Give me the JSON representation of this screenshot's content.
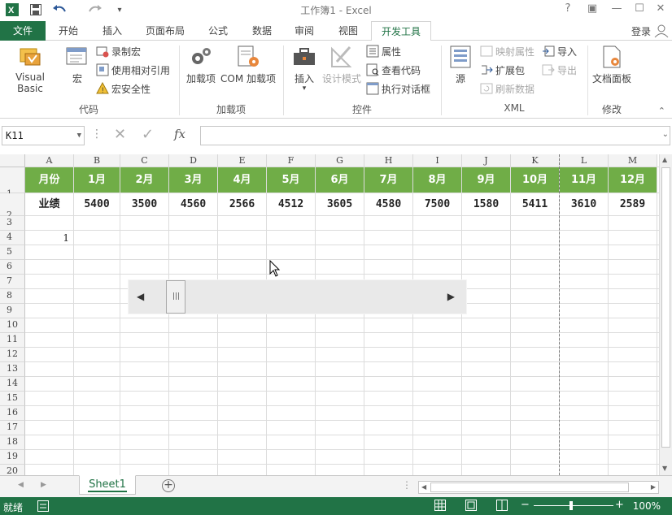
{
  "app": {
    "title": "工作簿1 - Excel",
    "login": "登录"
  },
  "tabs": [
    "文件",
    "开始",
    "插入",
    "页面布局",
    "公式",
    "数据",
    "审阅",
    "视图",
    "开发工具"
  ],
  "ribbon": {
    "groups": [
      {
        "label": "代码",
        "big": [
          "Visual Basic",
          "宏"
        ],
        "small": [
          "录制宏",
          "使用相对引用",
          "宏安全性"
        ]
      },
      {
        "label": "加载项",
        "big": [
          "加载项",
          "COM 加载项"
        ]
      },
      {
        "label": "控件",
        "big": [
          "插入",
          "设计模式"
        ],
        "small": [
          "属性",
          "查看代码",
          "执行对话框"
        ]
      },
      {
        "label": "XML",
        "big": [
          "源"
        ],
        "small": [
          "映射属性",
          "扩展包",
          "刷新数据",
          "导入",
          "导出"
        ]
      },
      {
        "label": "修改",
        "big": [
          "文档面板"
        ]
      }
    ]
  },
  "formula_bar": {
    "name_box": "K11",
    "fx": "fx",
    "value": ""
  },
  "grid": {
    "columns": [
      "A",
      "B",
      "C",
      "D",
      "E",
      "F",
      "G",
      "H",
      "I",
      "J",
      "K",
      "L",
      "M"
    ],
    "rows": [
      "1",
      "2",
      "3",
      "4",
      "5",
      "6",
      "7",
      "8",
      "9",
      "10",
      "11",
      "12",
      "13",
      "14",
      "15",
      "16",
      "17",
      "18",
      "19",
      "20"
    ],
    "row1": [
      "月份",
      "1月",
      "2月",
      "3月",
      "4月",
      "5月",
      "6月",
      "7月",
      "8月",
      "9月",
      "10月",
      "11月",
      "12月"
    ],
    "row2": [
      "业绩",
      "5400",
      "3500",
      "4560",
      "2566",
      "4512",
      "3605",
      "4580",
      "7500",
      "1580",
      "5411",
      "3610",
      "2589"
    ],
    "a4": "1",
    "header_color": "#70ad47"
  },
  "sheet": {
    "tabs": [
      "Sheet1"
    ]
  },
  "status": {
    "text": "就绪",
    "zoom": "100%"
  }
}
